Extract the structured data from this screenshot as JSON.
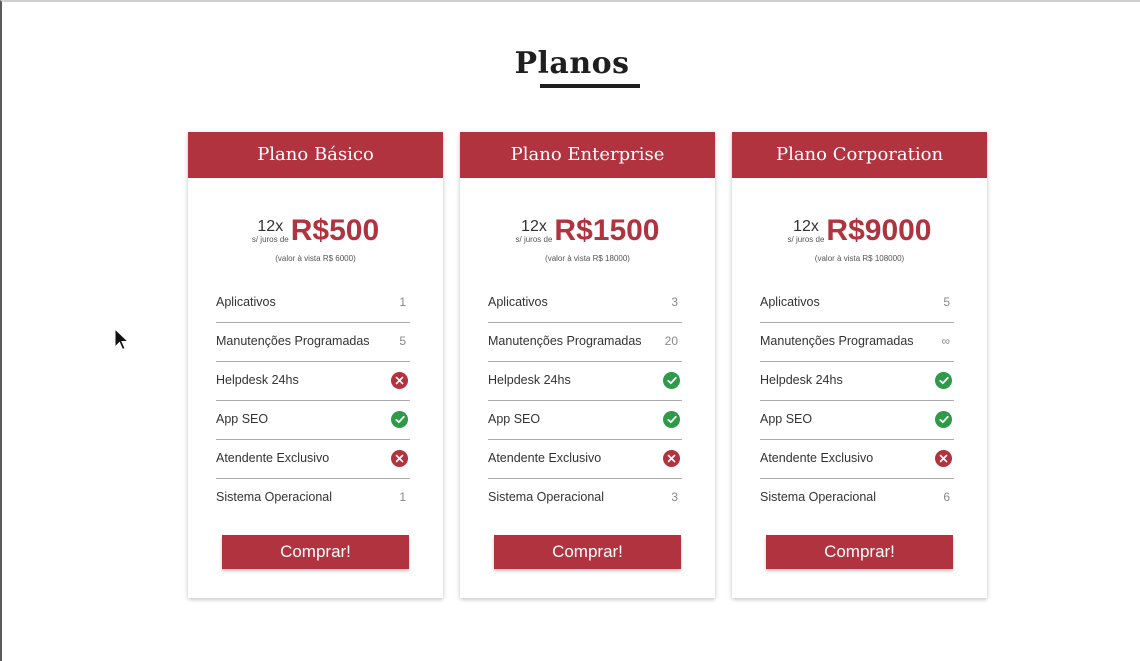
{
  "page": {
    "title": "Planos"
  },
  "colors": {
    "brand": "#b0333f",
    "success": "#2e9a4a"
  },
  "plans": [
    {
      "name": "Plano Básico",
      "installments": "12x",
      "installment_note": "s/ juros de",
      "price": "R$500",
      "cash_note": "(valor à vista R$ 6000)",
      "features": [
        {
          "label": "Aplicativos",
          "value": "1"
        },
        {
          "label": "Manutenções Programadas",
          "value": "5"
        },
        {
          "label": "Helpdesk 24hs",
          "icon": "x-circle-icon"
        },
        {
          "label": "App SEO",
          "icon": "check-circle-icon"
        },
        {
          "label": "Atendente Exclusivo",
          "icon": "x-circle-icon"
        },
        {
          "label": "Sistema Operacional",
          "value": "1"
        }
      ],
      "button_label": "Comprar!"
    },
    {
      "name": "Plano Enterprise",
      "installments": "12x",
      "installment_note": "s/ juros de",
      "price": "R$1500",
      "cash_note": "(valor à vista R$ 18000)",
      "features": [
        {
          "label": "Aplicativos",
          "value": "3"
        },
        {
          "label": "Manutenções Programadas",
          "value": "20"
        },
        {
          "label": "Helpdesk 24hs",
          "icon": "check-circle-icon"
        },
        {
          "label": "App SEO",
          "icon": "check-circle-icon"
        },
        {
          "label": "Atendente Exclusivo",
          "icon": "x-circle-icon"
        },
        {
          "label": "Sistema Operacional",
          "value": "3"
        }
      ],
      "button_label": "Comprar!"
    },
    {
      "name": "Plano Corporation",
      "installments": "12x",
      "installment_note": "s/ juros de",
      "price": "R$9000",
      "cash_note": "(valor à vista R$ 108000)",
      "features": [
        {
          "label": "Aplicativos",
          "value": "5"
        },
        {
          "label": "Manutenções Programadas",
          "value": "∞"
        },
        {
          "label": "Helpdesk 24hs",
          "icon": "check-circle-icon"
        },
        {
          "label": "App SEO",
          "icon": "check-circle-icon"
        },
        {
          "label": "Atendente Exclusivo",
          "icon": "x-circle-icon"
        },
        {
          "label": "Sistema Operacional",
          "value": "6"
        }
      ],
      "button_label": "Comprar!"
    }
  ]
}
